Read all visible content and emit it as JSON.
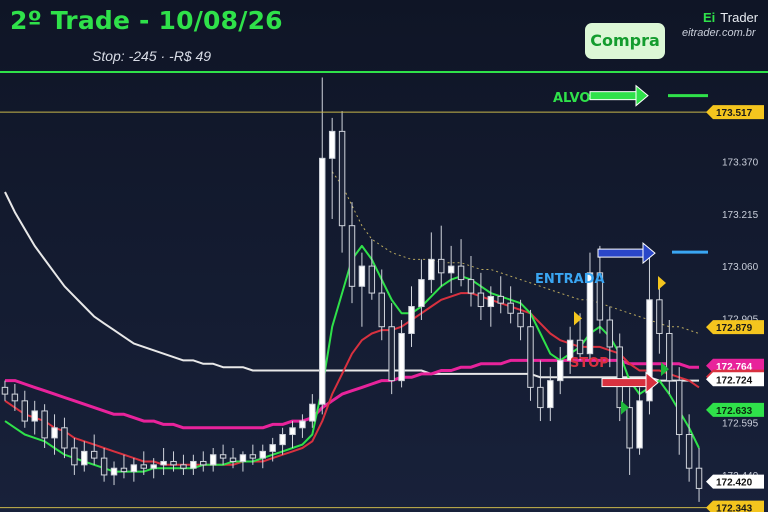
{
  "header": {
    "title": "2º Trade - 10/08/26",
    "subtitle": "Stop: -245 · -R$ 49",
    "badge": "Compra",
    "brand_ei": "Ei",
    "brand_name": "Trader",
    "site": "eitrader.com.br"
  },
  "annotations": {
    "alvo": "ALVO",
    "entrada": "ENTRADA",
    "stop": "STOP"
  },
  "colors": {
    "green": "#2fe14a",
    "red": "#d8313f",
    "pink": "#e8239b",
    "white": "#f0f0f0",
    "blue": "#2a46c8",
    "cyan": "#3aa6f2",
    "gold": "#f4c51e"
  },
  "chart_data": {
    "type": "candlestick",
    "ylim": [
      172.33,
      173.66
    ],
    "y_ticks": [
      "173.370",
      "173.215",
      "173.060",
      "172.905",
      "172.750",
      "172.595",
      "172.440"
    ],
    "price_labels": [
      {
        "value": 173.517,
        "text": "173.517",
        "style": "gold"
      },
      {
        "value": 172.879,
        "text": "172.879",
        "style": "gold"
      },
      {
        "value": 172.764,
        "text": "172.764",
        "style": "pink"
      },
      {
        "value": 172.732,
        "text": "172.732",
        "style": "red"
      },
      {
        "value": 172.724,
        "text": "172.724",
        "style": "white"
      },
      {
        "value": 172.633,
        "text": "172.633",
        "style": "green"
      },
      {
        "value": 172.42,
        "text": "172.420",
        "style": "white"
      },
      {
        "value": 172.343,
        "text": "172.343",
        "style": "gold"
      }
    ],
    "levels": {
      "alvo": 173.517,
      "entrada": 173.06,
      "stop": 172.732,
      "support": 172.343
    },
    "candles": [
      [
        172.7,
        172.72,
        172.66,
        172.68
      ],
      [
        172.68,
        172.71,
        172.63,
        172.66
      ],
      [
        172.66,
        172.69,
        172.58,
        172.6
      ],
      [
        172.6,
        172.66,
        172.56,
        172.63
      ],
      [
        172.63,
        172.65,
        172.52,
        172.55
      ],
      [
        172.55,
        172.62,
        172.5,
        172.58
      ],
      [
        172.58,
        172.61,
        172.49,
        172.52
      ],
      [
        172.52,
        172.55,
        172.44,
        172.47
      ],
      [
        172.47,
        172.54,
        172.45,
        172.51
      ],
      [
        172.51,
        172.56,
        172.47,
        172.49
      ],
      [
        172.49,
        172.52,
        172.42,
        172.44
      ],
      [
        172.44,
        172.48,
        172.41,
        172.46
      ],
      [
        172.46,
        172.5,
        172.43,
        172.45
      ],
      [
        172.45,
        172.49,
        172.42,
        172.47
      ],
      [
        172.47,
        172.51,
        172.44,
        172.46
      ],
      [
        172.46,
        172.49,
        172.43,
        172.47
      ],
      [
        172.47,
        172.52,
        172.44,
        172.48
      ],
      [
        172.48,
        172.51,
        172.45,
        172.47
      ],
      [
        172.47,
        172.5,
        172.44,
        172.46
      ],
      [
        172.46,
        172.5,
        172.44,
        172.48
      ],
      [
        172.48,
        172.51,
        172.45,
        172.47
      ],
      [
        172.47,
        172.52,
        172.45,
        172.5
      ],
      [
        172.5,
        172.53,
        172.47,
        172.49
      ],
      [
        172.49,
        172.52,
        172.46,
        172.48
      ],
      [
        172.48,
        172.51,
        172.45,
        172.5
      ],
      [
        172.5,
        172.53,
        172.47,
        172.49
      ],
      [
        172.49,
        172.53,
        172.46,
        172.51
      ],
      [
        172.51,
        172.55,
        172.48,
        172.53
      ],
      [
        172.53,
        172.58,
        172.5,
        172.56
      ],
      [
        172.56,
        172.6,
        172.52,
        172.58
      ],
      [
        172.58,
        172.62,
        172.55,
        172.6
      ],
      [
        172.6,
        172.68,
        172.58,
        172.65
      ],
      [
        172.65,
        173.62,
        172.62,
        173.38
      ],
      [
        173.38,
        173.5,
        173.2,
        173.46
      ],
      [
        173.46,
        173.52,
        173.1,
        173.18
      ],
      [
        173.18,
        173.25,
        172.95,
        173.0
      ],
      [
        173.0,
        173.1,
        172.88,
        173.06
      ],
      [
        173.06,
        173.14,
        172.96,
        172.98
      ],
      [
        172.98,
        173.05,
        172.84,
        172.88
      ],
      [
        172.88,
        172.95,
        172.68,
        172.72
      ],
      [
        172.72,
        172.9,
        172.7,
        172.86
      ],
      [
        172.86,
        173.0,
        172.82,
        172.94
      ],
      [
        172.94,
        173.08,
        172.9,
        173.02
      ],
      [
        173.02,
        173.16,
        172.98,
        173.08
      ],
      [
        173.08,
        173.18,
        173.0,
        173.04
      ],
      [
        173.04,
        173.12,
        172.98,
        173.06
      ],
      [
        173.06,
        173.14,
        173.0,
        173.02
      ],
      [
        173.02,
        173.09,
        172.94,
        172.98
      ],
      [
        172.98,
        173.04,
        172.9,
        172.94
      ],
      [
        172.94,
        173.0,
        172.88,
        172.97
      ],
      [
        172.97,
        173.03,
        172.92,
        172.95
      ],
      [
        172.95,
        173.0,
        172.89,
        172.92
      ],
      [
        172.92,
        172.96,
        172.84,
        172.88
      ],
      [
        172.88,
        172.93,
        172.66,
        172.7
      ],
      [
        172.7,
        172.78,
        172.6,
        172.64
      ],
      [
        172.64,
        172.76,
        172.6,
        172.72
      ],
      [
        172.72,
        172.82,
        172.68,
        172.78
      ],
      [
        172.78,
        172.88,
        172.74,
        172.84
      ],
      [
        172.84,
        172.92,
        172.78,
        172.8
      ],
      [
        172.8,
        173.1,
        172.78,
        173.04
      ],
      [
        173.04,
        173.12,
        172.86,
        172.9
      ],
      [
        172.9,
        172.94,
        172.76,
        172.82
      ],
      [
        172.82,
        172.86,
        172.6,
        172.64
      ],
      [
        172.64,
        172.7,
        172.44,
        172.52
      ],
      [
        172.52,
        172.7,
        172.5,
        172.66
      ],
      [
        172.66,
        173.1,
        172.62,
        172.96
      ],
      [
        172.96,
        173.02,
        172.8,
        172.86
      ],
      [
        172.86,
        172.9,
        172.68,
        172.72
      ],
      [
        172.72,
        172.76,
        172.5,
        172.56
      ],
      [
        172.56,
        172.62,
        172.42,
        172.46
      ],
      [
        172.46,
        172.52,
        172.36,
        172.4
      ]
    ],
    "ma_fast": [
      172.6,
      172.58,
      172.56,
      172.55,
      172.54,
      172.52,
      172.5,
      172.49,
      172.48,
      172.47,
      172.46,
      172.45,
      172.45,
      172.45,
      172.45,
      172.46,
      172.46,
      172.46,
      172.46,
      172.46,
      172.47,
      172.47,
      172.47,
      172.48,
      172.48,
      172.48,
      172.49,
      172.5,
      172.51,
      172.52,
      172.53,
      172.56,
      172.7,
      172.88,
      172.98,
      173.08,
      173.12,
      173.08,
      173.02,
      172.96,
      172.92,
      172.92,
      172.94,
      172.97,
      173.0,
      173.02,
      173.03,
      173.02,
      173.0,
      172.98,
      172.97,
      172.96,
      172.95,
      172.92,
      172.86,
      172.8,
      172.78,
      172.8,
      172.82,
      172.86,
      172.88,
      172.85,
      172.8,
      172.72,
      172.68,
      172.7,
      172.72,
      172.68,
      172.63,
      172.58,
      172.52
    ],
    "ma_mid": [
      172.66,
      172.64,
      172.62,
      172.61,
      172.6,
      172.58,
      172.57,
      172.55,
      172.54,
      172.53,
      172.52,
      172.51,
      172.5,
      172.49,
      172.48,
      172.48,
      172.47,
      172.47,
      172.47,
      172.47,
      172.47,
      172.47,
      172.47,
      172.47,
      172.48,
      172.48,
      172.48,
      172.49,
      172.5,
      172.51,
      172.52,
      172.54,
      172.6,
      172.68,
      172.74,
      172.8,
      172.84,
      172.86,
      172.87,
      172.87,
      172.88,
      172.9,
      172.92,
      172.94,
      172.96,
      172.97,
      172.98,
      172.98,
      172.97,
      172.96,
      172.95,
      172.94,
      172.93,
      172.92,
      172.89,
      172.86,
      172.84,
      172.83,
      172.82,
      172.82,
      172.82,
      172.81,
      172.8,
      172.77,
      172.75,
      172.75,
      172.75,
      172.74,
      172.73,
      172.72,
      172.7
    ],
    "ma_pink": [
      172.72,
      172.72,
      172.71,
      172.7,
      172.69,
      172.68,
      172.67,
      172.66,
      172.65,
      172.64,
      172.63,
      172.62,
      172.62,
      172.61,
      172.6,
      172.6,
      172.59,
      172.59,
      172.58,
      172.58,
      172.58,
      172.58,
      172.58,
      172.58,
      172.58,
      172.58,
      172.58,
      172.59,
      172.59,
      172.6,
      172.6,
      172.61,
      172.64,
      172.66,
      172.68,
      172.69,
      172.7,
      172.71,
      172.72,
      172.72,
      172.73,
      172.73,
      172.74,
      172.74,
      172.75,
      172.75,
      172.76,
      172.76,
      172.77,
      172.77,
      172.77,
      172.78,
      172.78,
      172.78,
      172.78,
      172.78,
      172.78,
      172.78,
      172.78,
      172.78,
      172.78,
      172.78,
      172.78,
      172.77,
      172.77,
      172.77,
      172.77,
      172.77,
      172.77,
      172.76,
      172.76
    ],
    "ma_white": [
      173.28,
      173.22,
      173.17,
      173.12,
      173.08,
      173.04,
      173.0,
      172.97,
      172.94,
      172.91,
      172.89,
      172.87,
      172.85,
      172.83,
      172.82,
      172.81,
      172.8,
      172.79,
      172.78,
      172.78,
      172.77,
      172.77,
      172.76,
      172.76,
      172.76,
      172.75,
      172.75,
      172.75,
      172.75,
      172.75,
      172.75,
      172.75,
      172.75,
      172.75,
      172.75,
      172.75,
      172.75,
      172.75,
      172.75,
      172.75,
      172.75,
      172.75,
      172.75,
      172.74,
      172.74,
      172.74,
      172.74,
      172.74,
      172.74,
      172.74,
      172.74,
      172.74,
      172.74,
      172.74,
      172.73,
      172.73,
      172.73,
      172.73,
      172.73,
      172.73,
      172.73,
      172.73,
      172.73,
      172.73,
      172.73,
      172.73,
      172.72,
      172.72,
      172.72,
      172.72,
      172.72
    ],
    "vwap": [
      null,
      null,
      null,
      null,
      null,
      null,
      null,
      null,
      null,
      null,
      null,
      null,
      null,
      null,
      null,
      null,
      null,
      null,
      null,
      null,
      null,
      null,
      null,
      null,
      null,
      null,
      null,
      null,
      null,
      null,
      null,
      null,
      null,
      173.34,
      173.3,
      173.24,
      173.18,
      173.14,
      173.12,
      173.1,
      173.09,
      173.08,
      173.08,
      173.08,
      173.07,
      173.07,
      173.07,
      173.06,
      173.05,
      173.05,
      173.04,
      173.03,
      173.02,
      173.01,
      173.0,
      172.99,
      172.98,
      172.97,
      172.96,
      172.96,
      172.95,
      172.94,
      172.93,
      172.92,
      172.91,
      172.9,
      172.89,
      172.88,
      172.88,
      172.87,
      172.86
    ]
  }
}
